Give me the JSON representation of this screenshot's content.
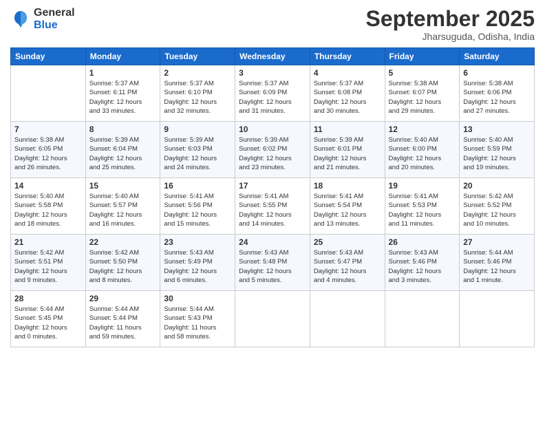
{
  "logo": {
    "general": "General",
    "blue": "Blue"
  },
  "header": {
    "month": "September 2025",
    "location": "Jharsuguda, Odisha, India"
  },
  "weekdays": [
    "Sunday",
    "Monday",
    "Tuesday",
    "Wednesday",
    "Thursday",
    "Friday",
    "Saturday"
  ],
  "weeks": [
    [
      {
        "day": "",
        "info": ""
      },
      {
        "day": "1",
        "info": "Sunrise: 5:37 AM\nSunset: 6:11 PM\nDaylight: 12 hours\nand 33 minutes."
      },
      {
        "day": "2",
        "info": "Sunrise: 5:37 AM\nSunset: 6:10 PM\nDaylight: 12 hours\nand 32 minutes."
      },
      {
        "day": "3",
        "info": "Sunrise: 5:37 AM\nSunset: 6:09 PM\nDaylight: 12 hours\nand 31 minutes."
      },
      {
        "day": "4",
        "info": "Sunrise: 5:37 AM\nSunset: 6:08 PM\nDaylight: 12 hours\nand 30 minutes."
      },
      {
        "day": "5",
        "info": "Sunrise: 5:38 AM\nSunset: 6:07 PM\nDaylight: 12 hours\nand 29 minutes."
      },
      {
        "day": "6",
        "info": "Sunrise: 5:38 AM\nSunset: 6:06 PM\nDaylight: 12 hours\nand 27 minutes."
      }
    ],
    [
      {
        "day": "7",
        "info": "Sunrise: 5:38 AM\nSunset: 6:05 PM\nDaylight: 12 hours\nand 26 minutes."
      },
      {
        "day": "8",
        "info": "Sunrise: 5:39 AM\nSunset: 6:04 PM\nDaylight: 12 hours\nand 25 minutes."
      },
      {
        "day": "9",
        "info": "Sunrise: 5:39 AM\nSunset: 6:03 PM\nDaylight: 12 hours\nand 24 minutes."
      },
      {
        "day": "10",
        "info": "Sunrise: 5:39 AM\nSunset: 6:02 PM\nDaylight: 12 hours\nand 23 minutes."
      },
      {
        "day": "11",
        "info": "Sunrise: 5:39 AM\nSunset: 6:01 PM\nDaylight: 12 hours\nand 21 minutes."
      },
      {
        "day": "12",
        "info": "Sunrise: 5:40 AM\nSunset: 6:00 PM\nDaylight: 12 hours\nand 20 minutes."
      },
      {
        "day": "13",
        "info": "Sunrise: 5:40 AM\nSunset: 5:59 PM\nDaylight: 12 hours\nand 19 minutes."
      }
    ],
    [
      {
        "day": "14",
        "info": "Sunrise: 5:40 AM\nSunset: 5:58 PM\nDaylight: 12 hours\nand 18 minutes."
      },
      {
        "day": "15",
        "info": "Sunrise: 5:40 AM\nSunset: 5:57 PM\nDaylight: 12 hours\nand 16 minutes."
      },
      {
        "day": "16",
        "info": "Sunrise: 5:41 AM\nSunset: 5:56 PM\nDaylight: 12 hours\nand 15 minutes."
      },
      {
        "day": "17",
        "info": "Sunrise: 5:41 AM\nSunset: 5:55 PM\nDaylight: 12 hours\nand 14 minutes."
      },
      {
        "day": "18",
        "info": "Sunrise: 5:41 AM\nSunset: 5:54 PM\nDaylight: 12 hours\nand 13 minutes."
      },
      {
        "day": "19",
        "info": "Sunrise: 5:41 AM\nSunset: 5:53 PM\nDaylight: 12 hours\nand 11 minutes."
      },
      {
        "day": "20",
        "info": "Sunrise: 5:42 AM\nSunset: 5:52 PM\nDaylight: 12 hours\nand 10 minutes."
      }
    ],
    [
      {
        "day": "21",
        "info": "Sunrise: 5:42 AM\nSunset: 5:51 PM\nDaylight: 12 hours\nand 9 minutes."
      },
      {
        "day": "22",
        "info": "Sunrise: 5:42 AM\nSunset: 5:50 PM\nDaylight: 12 hours\nand 8 minutes."
      },
      {
        "day": "23",
        "info": "Sunrise: 5:43 AM\nSunset: 5:49 PM\nDaylight: 12 hours\nand 6 minutes."
      },
      {
        "day": "24",
        "info": "Sunrise: 5:43 AM\nSunset: 5:48 PM\nDaylight: 12 hours\nand 5 minutes."
      },
      {
        "day": "25",
        "info": "Sunrise: 5:43 AM\nSunset: 5:47 PM\nDaylight: 12 hours\nand 4 minutes."
      },
      {
        "day": "26",
        "info": "Sunrise: 5:43 AM\nSunset: 5:46 PM\nDaylight: 12 hours\nand 3 minutes."
      },
      {
        "day": "27",
        "info": "Sunrise: 5:44 AM\nSunset: 5:46 PM\nDaylight: 12 hours\nand 1 minute."
      }
    ],
    [
      {
        "day": "28",
        "info": "Sunrise: 5:44 AM\nSunset: 5:45 PM\nDaylight: 12 hours\nand 0 minutes."
      },
      {
        "day": "29",
        "info": "Sunrise: 5:44 AM\nSunset: 5:44 PM\nDaylight: 11 hours\nand 59 minutes."
      },
      {
        "day": "30",
        "info": "Sunrise: 5:44 AM\nSunset: 5:43 PM\nDaylight: 11 hours\nand 58 minutes."
      },
      {
        "day": "",
        "info": ""
      },
      {
        "day": "",
        "info": ""
      },
      {
        "day": "",
        "info": ""
      },
      {
        "day": "",
        "info": ""
      }
    ]
  ]
}
